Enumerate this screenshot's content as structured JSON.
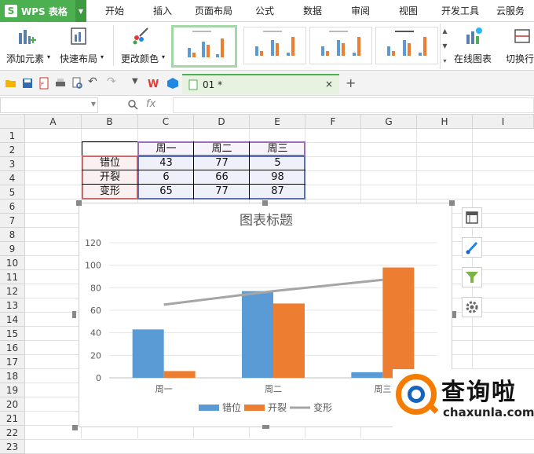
{
  "app": {
    "title": "WPS 表格",
    "logo": "S"
  },
  "menu": [
    "开始",
    "插入",
    "页面布局",
    "公式",
    "数据",
    "审阅",
    "视图",
    "开发工具",
    "云服务"
  ],
  "ribbon": {
    "add_element": "添加元素",
    "quick_layout": "快速布局",
    "change_color": "更改颜色",
    "online_chart": "在线图表",
    "switch_row_col": "切换行"
  },
  "quick_toolbar": {
    "doc_tab": "01 *",
    "close": "×",
    "add_tab": "+"
  },
  "formula_bar": {
    "fx": "fx",
    "name_box": "",
    "formula": ""
  },
  "grid": {
    "columns": [
      "A",
      "B",
      "C",
      "D",
      "E",
      "F",
      "G",
      "H",
      "I"
    ],
    "rows": [
      "1",
      "2",
      "3",
      "4",
      "5",
      "6",
      "7",
      "8",
      "9",
      "10",
      "11",
      "12",
      "13",
      "14",
      "15",
      "16",
      "17",
      "18",
      "19",
      "20",
      "21",
      "22",
      "23"
    ],
    "table": {
      "headers": [
        "周一",
        "周二",
        "周三"
      ],
      "rows": [
        {
          "label": "错位",
          "values": [
            "43",
            "77",
            "5"
          ]
        },
        {
          "label": "开裂",
          "values": [
            "6",
            "66",
            "98"
          ]
        },
        {
          "label": "变形",
          "values": [
            "65",
            "77",
            "87"
          ]
        }
      ]
    }
  },
  "chart_data": {
    "type": "bar",
    "title": "图表标题",
    "categories": [
      "周一",
      "周二",
      "周三"
    ],
    "series": [
      {
        "name": "错位",
        "type": "bar",
        "values": [
          43,
          77,
          5
        ],
        "color": "#5b9bd5"
      },
      {
        "name": "开裂",
        "type": "bar",
        "values": [
          6,
          66,
          98
        ],
        "color": "#ed7d31"
      },
      {
        "name": "变形",
        "type": "line",
        "values": [
          65,
          77,
          87
        ],
        "color": "#a5a5a5"
      }
    ],
    "ylim": [
      0,
      120
    ],
    "yticks": [
      0,
      20,
      40,
      60,
      80,
      100,
      120
    ],
    "legend": "bottom",
    "grid": true
  },
  "watermark": {
    "text": "查询啦",
    "url_text": "chaxunla.com"
  },
  "colors": {
    "brand": "#4caf50",
    "bar1": "#5b9bd5",
    "bar2": "#ed7d31",
    "line": "#a5a5a5"
  }
}
